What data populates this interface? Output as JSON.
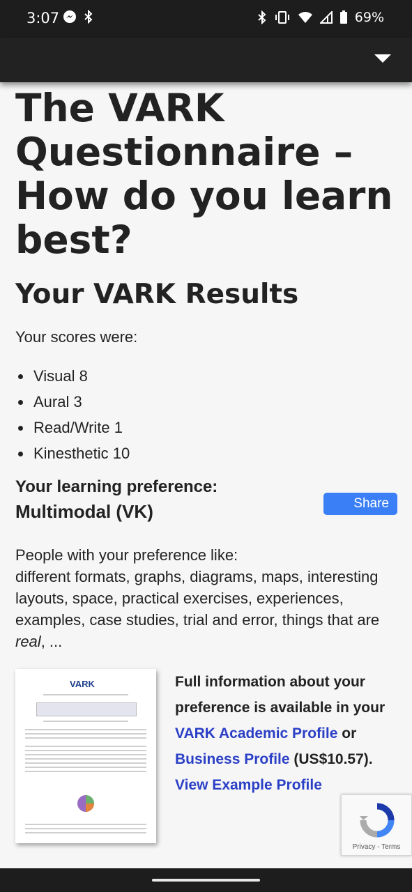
{
  "status_bar": {
    "time": "3:07",
    "battery": "69%",
    "icons": [
      "messenger-icon",
      "bluetooth-icon",
      "vibrate-icon",
      "wifi-icon",
      "signal-icon",
      "battery-icon"
    ]
  },
  "page": {
    "title": "The VARK Questionnaire – How do you learn best?",
    "results_heading": "Your VARK Results",
    "scores_intro": "Your scores were:",
    "scores": [
      {
        "label": "Visual 8"
      },
      {
        "label": "Aural 3"
      },
      {
        "label": "Read/Write 1"
      },
      {
        "label": "Kinesthetic 10"
      }
    ],
    "preference_label": "Your learning preference:",
    "preference_value": "Multimodal (VK)",
    "share_label": "Share",
    "likes_intro": "People with your preference like:",
    "likes_text": "different formats, graphs, diagrams, maps, interesting layouts, space, practical exercises, experiences, examples, case studies, trial and error, things that are ",
    "likes_italic": "real",
    "likes_end": ", ...",
    "thumbnail_logo": "VARK",
    "full_info_1": "Full information about your preference is available in your ",
    "academic_link": "VARK Academic Profile",
    "or_text": " or ",
    "business_link": "Business Profile",
    "price_text": " (US$10.57).",
    "example_link": "View Example Profile"
  },
  "recaptcha": {
    "privacy": "Privacy",
    "sep": " - ",
    "terms": "Terms"
  },
  "colors": {
    "link": "#2a3fc6",
    "share_button": "#3a7ff6",
    "bar": "#1d1d1d"
  }
}
